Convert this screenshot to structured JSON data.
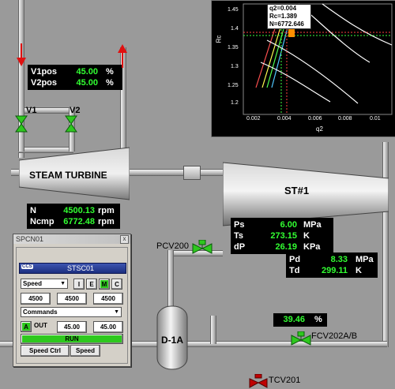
{
  "valves_readout": {
    "rows": [
      {
        "label": "V1pos",
        "value": "45.00",
        "unit": "%"
      },
      {
        "label": "V2pos",
        "value": "45.00",
        "unit": "%"
      }
    ]
  },
  "valve_labels": {
    "v1": "V1",
    "v2": "V2"
  },
  "turbine": {
    "label": "STEAM TURBINE"
  },
  "speed_readout": {
    "rows": [
      {
        "label": "N",
        "value": "4500.13",
        "unit": "rpm"
      },
      {
        "label": "Ncmp",
        "value": "6772.48",
        "unit": "rpm"
      }
    ]
  },
  "compressor": {
    "label": "ST#1"
  },
  "suction_readout": {
    "rows": [
      {
        "label": "Ps",
        "value": "6.00",
        "unit": "MPa"
      },
      {
        "label": "Ts",
        "value": "273.15",
        "unit": "K"
      },
      {
        "label": "dP",
        "value": "26.19",
        "unit": "KPa"
      }
    ]
  },
  "discharge_readout": {
    "rows": [
      {
        "label": "Pd",
        "value": "8.33",
        "unit": "MPa"
      },
      {
        "label": "Td",
        "value": "299.11",
        "unit": "K"
      }
    ]
  },
  "pcv200": {
    "label": "PCV200"
  },
  "separator": {
    "label": "D-1A"
  },
  "fcv202": {
    "label": "FCV202A/B",
    "value": "39.46",
    "unit": "%"
  },
  "tcv201": {
    "label": "TCV201"
  },
  "map": {
    "tooltip": [
      "q2=0.004",
      "Rc=1.389",
      "N=6772.646"
    ],
    "xlabel": "q2",
    "ylabel": "Rc",
    "yticks": [
      "1.45",
      "1.4",
      "1.35",
      "1.3",
      "1.25",
      "1.2"
    ],
    "xticks": [
      "0.002",
      "0.004",
      "0.006",
      "0.008",
      "0.01"
    ]
  },
  "controller": {
    "window_title": "SPCN01",
    "close": "x",
    "logo": "CCS",
    "name": "STSC01",
    "mode_select": "Speed",
    "mode_buttons": [
      "I",
      "E",
      "M",
      "C"
    ],
    "values": [
      "4500",
      "4500",
      "4500"
    ],
    "commands_select": "Commands",
    "a_label": "A",
    "out_label": "OUT",
    "out_values": [
      "45.00",
      "45.00"
    ],
    "run_label": "RUN",
    "bottom_buttons": [
      "Speed Ctrl",
      "Speed"
    ]
  },
  "colors": {
    "green_value": "#32ff32",
    "valve_green": "#2ec81e",
    "arrow_red": "#e01010",
    "trip_red": "#c00000"
  }
}
